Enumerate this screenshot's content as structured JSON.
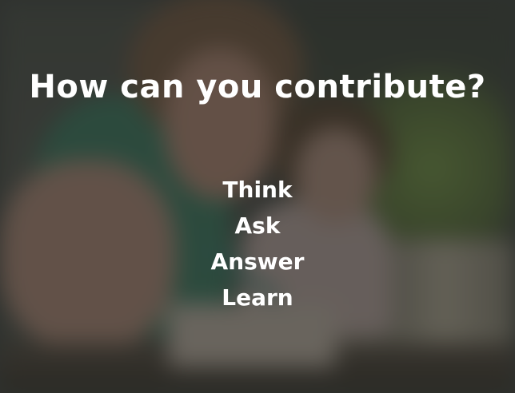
{
  "headline": "How can you contribute?",
  "actions": [
    "Think",
    "Ask",
    "Answer",
    "Learn"
  ]
}
